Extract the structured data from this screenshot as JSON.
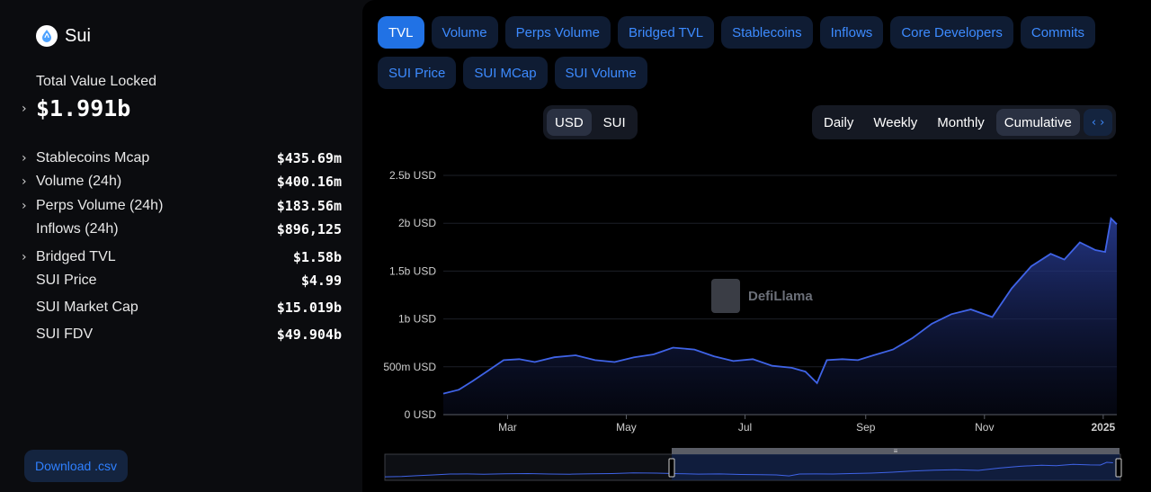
{
  "chain": {
    "name": "Sui",
    "logo_icon": "sui-droplet-icon"
  },
  "summary": {
    "tvl_label": "Total Value Locked",
    "tvl_value": "$1.991b"
  },
  "metrics": [
    {
      "label": "Stablecoins Mcap",
      "value": "$435.69m",
      "expandable": true
    },
    {
      "label": "Volume (24h)",
      "value": "$400.16m",
      "expandable": true
    },
    {
      "label": "Perps Volume (24h)",
      "value": "$183.56m",
      "expandable": true
    },
    {
      "label": "Inflows (24h)",
      "value": "$896,125",
      "expandable": false
    },
    {
      "label": "Bridged TVL",
      "value": "$1.58b",
      "expandable": true
    },
    {
      "label": "SUI Price",
      "value": "$4.99",
      "expandable": false
    },
    {
      "label": "SUI Market Cap",
      "value": "$15.019b",
      "expandable": false
    },
    {
      "label": "SUI FDV",
      "value": "$49.904b",
      "expandable": false
    }
  ],
  "download_label": "Download .csv",
  "tabs_row1": [
    "TVL",
    "Volume",
    "Perps Volume",
    "Bridged TVL",
    "Stablecoins",
    "Inflows",
    "Core Developers",
    "Commits"
  ],
  "tabs_row2": [
    "SUI Price",
    "SUI MCap",
    "SUI Volume"
  ],
  "active_tab": "TVL",
  "denomination": {
    "options": [
      "USD",
      "SUI"
    ],
    "selected": "USD"
  },
  "period": {
    "options": [
      "Daily",
      "Weekly",
      "Monthly",
      "Cumulative"
    ],
    "selected": "Cumulative",
    "embed_icon": "code-brackets-icon"
  },
  "watermark": {
    "text": "DefiLlama",
    "icon": "llama-icon"
  },
  "colors": {
    "accent": "#2172e5",
    "line": "#3f63e6",
    "tab_text": "#3d8bff"
  },
  "chart_data": {
    "type": "area",
    "series": [
      {
        "x": [
          "2024-01-28",
          "2024-02-05",
          "2024-02-12",
          "2024-02-20",
          "2024-02-28",
          "2024-03-07",
          "2024-03-15",
          "2024-03-25",
          "2024-04-05",
          "2024-04-15",
          "2024-04-25",
          "2024-05-05",
          "2024-05-15",
          "2024-05-25",
          "2024-06-05",
          "2024-06-15",
          "2024-06-25",
          "2024-07-05",
          "2024-07-15",
          "2024-07-25",
          "2024-08-01",
          "2024-08-07",
          "2024-08-12",
          "2024-08-20",
          "2024-08-28",
          "2024-09-05",
          "2024-09-15",
          "2024-09-25",
          "2024-10-05",
          "2024-10-15",
          "2024-10-25",
          "2024-11-05",
          "2024-11-15",
          "2024-11-25",
          "2024-12-05",
          "2024-12-12",
          "2024-12-20",
          "2024-12-28",
          "2025-01-02",
          "2025-01-05",
          "2025-01-08"
        ],
        "values": [
          0.22,
          0.26,
          0.35,
          0.46,
          0.57,
          0.58,
          0.55,
          0.6,
          0.62,
          0.57,
          0.55,
          0.6,
          0.63,
          0.7,
          0.68,
          0.61,
          0.56,
          0.58,
          0.51,
          0.49,
          0.45,
          0.33,
          0.57,
          0.58,
          0.57,
          0.62,
          0.68,
          0.8,
          0.95,
          1.05,
          1.1,
          1.02,
          1.32,
          1.55,
          1.68,
          1.62,
          1.8,
          1.72,
          1.7,
          2.05,
          1.99
        ]
      }
    ],
    "xticks": [
      "Mar",
      "May",
      "Jul",
      "Sep",
      "Nov",
      "2025"
    ],
    "yticks": [
      "0 USD",
      "500m USD",
      "1b USD",
      "1.5b USD",
      "2b USD",
      "2.5b USD"
    ],
    "ylim": [
      0,
      2.5
    ],
    "ylabel": "",
    "xlabel": "",
    "grid": true
  }
}
